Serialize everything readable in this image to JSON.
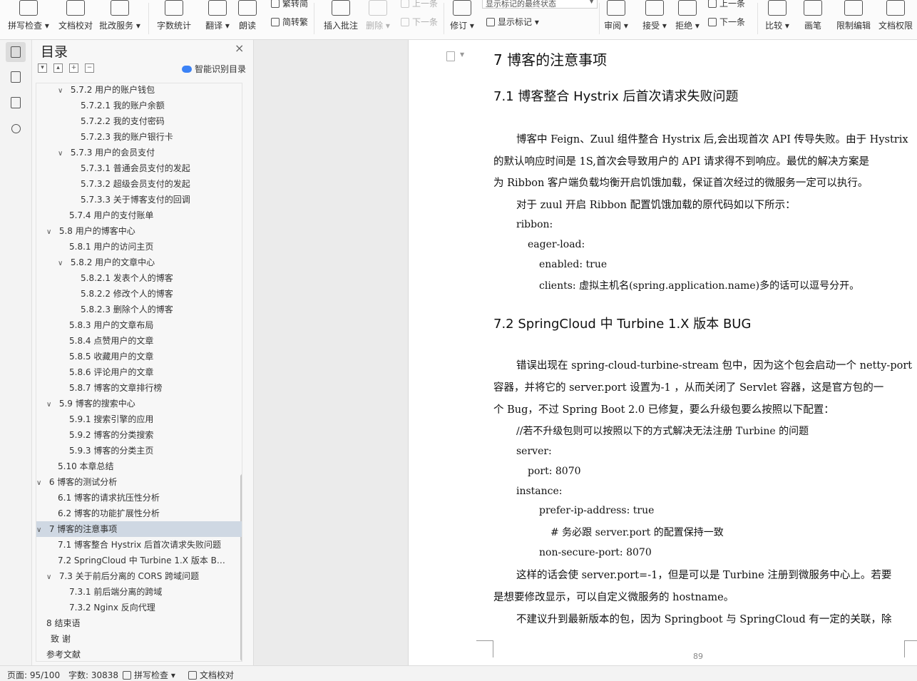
{
  "ribbon": {
    "buttons": [
      {
        "label": "拼写检查 ▾",
        "icon": "abc-check-icon",
        "dim": false
      },
      {
        "label": "文档校对",
        "icon": "doc-proof-icon",
        "dim": false
      },
      {
        "label": "批改服务 ▾",
        "icon": "review-service-icon",
        "dim": false
      },
      {
        "label": "字数统计",
        "icon": "word-count-icon",
        "dim": false
      },
      {
        "label": "翻译 ▾",
        "icon": "translate-icon",
        "dim": false
      },
      {
        "label": "朗读",
        "icon": "read-aloud-icon",
        "dim": false
      },
      {
        "label": "插入批注",
        "icon": "insert-comment-icon",
        "dim": false
      },
      {
        "label": "删除 ▾",
        "icon": "delete-comment-icon",
        "dim": true
      },
      {
        "label": "修订 ▾",
        "icon": "track-changes-icon",
        "dim": false
      },
      {
        "label": "审阅 ▾",
        "icon": "review-pane-icon",
        "dim": false
      },
      {
        "label": "接受 ▾",
        "icon": "accept-icon",
        "dim": false
      },
      {
        "label": "拒绝 ▾",
        "icon": "reject-icon",
        "dim": false
      },
      {
        "label": "比较 ▾",
        "icon": "compare-icon",
        "dim": false
      },
      {
        "label": "画笔",
        "icon": "pen-icon",
        "dim": false
      },
      {
        "label": "限制编辑",
        "icon": "restrict-edit-icon",
        "dim": false
      },
      {
        "label": "文档权限",
        "icon": "doc-permission-icon",
        "dim": false
      }
    ],
    "trad_simp": "繁转简",
    "simp_trad": "简转繁",
    "prev_comment": "上一条",
    "next_comment": "下一条",
    "markup_state": "显示标记的最终状态",
    "show_markup": "显示标记 ▾",
    "prev_change": "上一条",
    "next_change": "下一条"
  },
  "rail": {
    "icons": [
      "toc-icon",
      "nav-pane-icon",
      "bookmark-icon",
      "search-icon"
    ]
  },
  "toc": {
    "title": "目录",
    "smart_label": "智能识别目录",
    "items": [
      {
        "text": "5.7.2  用户的账户钱包",
        "level": 2,
        "chev": "∨"
      },
      {
        "text": "5.7.2.1  我的账户余额",
        "level": 3,
        "chev": ""
      },
      {
        "text": "5.7.2.2  我的支付密码",
        "level": 3,
        "chev": ""
      },
      {
        "text": "5.7.2.3  我的账户银行卡",
        "level": 3,
        "chev": ""
      },
      {
        "text": "5.7.3  用户的会员支付",
        "level": 2,
        "chev": "∨"
      },
      {
        "text": "5.7.3.1  普通会员支付的发起",
        "level": 3,
        "chev": ""
      },
      {
        "text": "5.7.3.2  超级会员支付的发起",
        "level": 3,
        "chev": ""
      },
      {
        "text": "5.7.3.3  关于博客支付的回调",
        "level": 3,
        "chev": ""
      },
      {
        "text": "5.7.4  用户的支付账单",
        "level": 2,
        "chev": ""
      },
      {
        "text": "5.8  用户的博客中心",
        "level": 1,
        "chev": "∨"
      },
      {
        "text": "5.8.1  用户的访问主页",
        "level": 2,
        "chev": ""
      },
      {
        "text": "5.8.2  用户的文章中心",
        "level": 2,
        "chev": "∨"
      },
      {
        "text": "5.8.2.1  发表个人的博客",
        "level": 3,
        "chev": ""
      },
      {
        "text": "5.8.2.2  修改个人的博客",
        "level": 3,
        "chev": ""
      },
      {
        "text": "5.8.2.3  删除个人的博客",
        "level": 3,
        "chev": ""
      },
      {
        "text": "5.8.3  用户的文章布局",
        "level": 2,
        "chev": ""
      },
      {
        "text": "5.8.4  点赞用户的文章",
        "level": 2,
        "chev": ""
      },
      {
        "text": "5.8.5  收藏用户的文章",
        "level": 2,
        "chev": ""
      },
      {
        "text": "5.8.6  评论用户的文章",
        "level": 2,
        "chev": ""
      },
      {
        "text": "5.8.7  博客的文章排行榜",
        "level": 2,
        "chev": ""
      },
      {
        "text": "5.9  博客的搜索中心",
        "level": 1,
        "chev": "∨"
      },
      {
        "text": "5.9.1  搜索引擎的应用",
        "level": 2,
        "chev": ""
      },
      {
        "text": "5.9.2  博客的分类搜索",
        "level": 2,
        "chev": ""
      },
      {
        "text": "5.9.3  博客的分类主页",
        "level": 2,
        "chev": ""
      },
      {
        "text": "5.10  本章总结",
        "level": 1,
        "chev": ""
      },
      {
        "text": "6  博客的测试分析",
        "level": 0,
        "chev": "∨"
      },
      {
        "text": "6.1  博客的请求抗压性分析",
        "level": 1,
        "chev": ""
      },
      {
        "text": "6.2  博客的功能扩展性分析",
        "level": 1,
        "chev": ""
      },
      {
        "text": "7  博客的注意事项",
        "level": 0,
        "chev": "∨",
        "selected": true
      },
      {
        "text": "7.1  博客整合 Hystrix 后首次请求失败问题",
        "level": 1,
        "chev": ""
      },
      {
        "text": "7.2 SpringCloud 中 Turbine 1.X 版本 BUG",
        "level": 1,
        "chev": ""
      },
      {
        "text": "7.3  关于前后分离的 CORS 跨域问题",
        "level": 1,
        "chev": "∨"
      },
      {
        "text": "7.3.1  前后端分离的跨域",
        "level": 2,
        "chev": ""
      },
      {
        "text": "7.3.2 Nginx 反向代理",
        "level": 2,
        "chev": ""
      },
      {
        "text": "8  结束语",
        "level": 0,
        "chev": ""
      },
      {
        "text": "致    谢",
        "level": 0,
        "chev": "",
        "extra": true
      },
      {
        "text": "参考文献",
        "level": 0,
        "chev": ""
      }
    ]
  },
  "doc": {
    "h1": "7  博客的注意事项",
    "h2_1": "7.1  博客整合 Hystrix 后首次请求失败问题",
    "p1_l1": "博客中 Feign、Zuul 组件整合 Hystrix 后,会出现首次 API 传导失败。由于 Hystrix",
    "p1_l2": "的默认响应时间是 1S,首次会导致用户的 API 请求得不到响应。最优的解决方案是",
    "p1_l3": "为 Ribbon 客户端负载均衡开启饥饿加载，保证首次经过的微服务一定可以执行。",
    "p2": "对于 zuul 开启 Ribbon 配置饥饿加载的原代码如以下所示：",
    "c1": "ribbon:",
    "c2": "eager-load:",
    "c3": "enabled: true",
    "c4": "clients:  虚拟主机名(spring.application.name)多的话可以逗号分开。",
    "h2_2": "7.2  SpringCloud 中 Turbine 1.X 版本 BUG",
    "p3_l1": "错误出现在 spring-cloud-turbine-stream  包中，因为这个包会启动一个 netty-port",
    "p3_l2": "容器，并将它的 server.port  设置为-1 ，从而关闭了 Servlet 容器，这是官方包的一",
    "p3_l3": "个 Bug，不过 Spring Boot 2.0 已修复，要么升级包要么按照以下配置：",
    "c5": "//若不升级包则可以按照以下的方式解决无法注册 Turbine 的问题",
    "c6": "server:",
    "c7": "port: 8070",
    "c8": "instance:",
    "c9": "prefer-ip-address: true",
    "c10": "#  务必跟 server.port 的配置保持一致",
    "c11": "non-secure-port: 8070",
    "p4_l1": "这样的话会使 server.port=-1，但是可以是 Turbine 注册到微服务中心上。若要",
    "p4_l2": "是想要修改显示，可以自定义微服务的 hostname。",
    "p5": "不建议升到最新版本的包，因为 Springboot 与 SpringCloud 有一定的关联，除",
    "page_number": "89"
  },
  "status": {
    "page": "页面: 95/100",
    "words": "字数: 30838",
    "spell": "拼写检查 ▾",
    "proof": "文档校对"
  }
}
